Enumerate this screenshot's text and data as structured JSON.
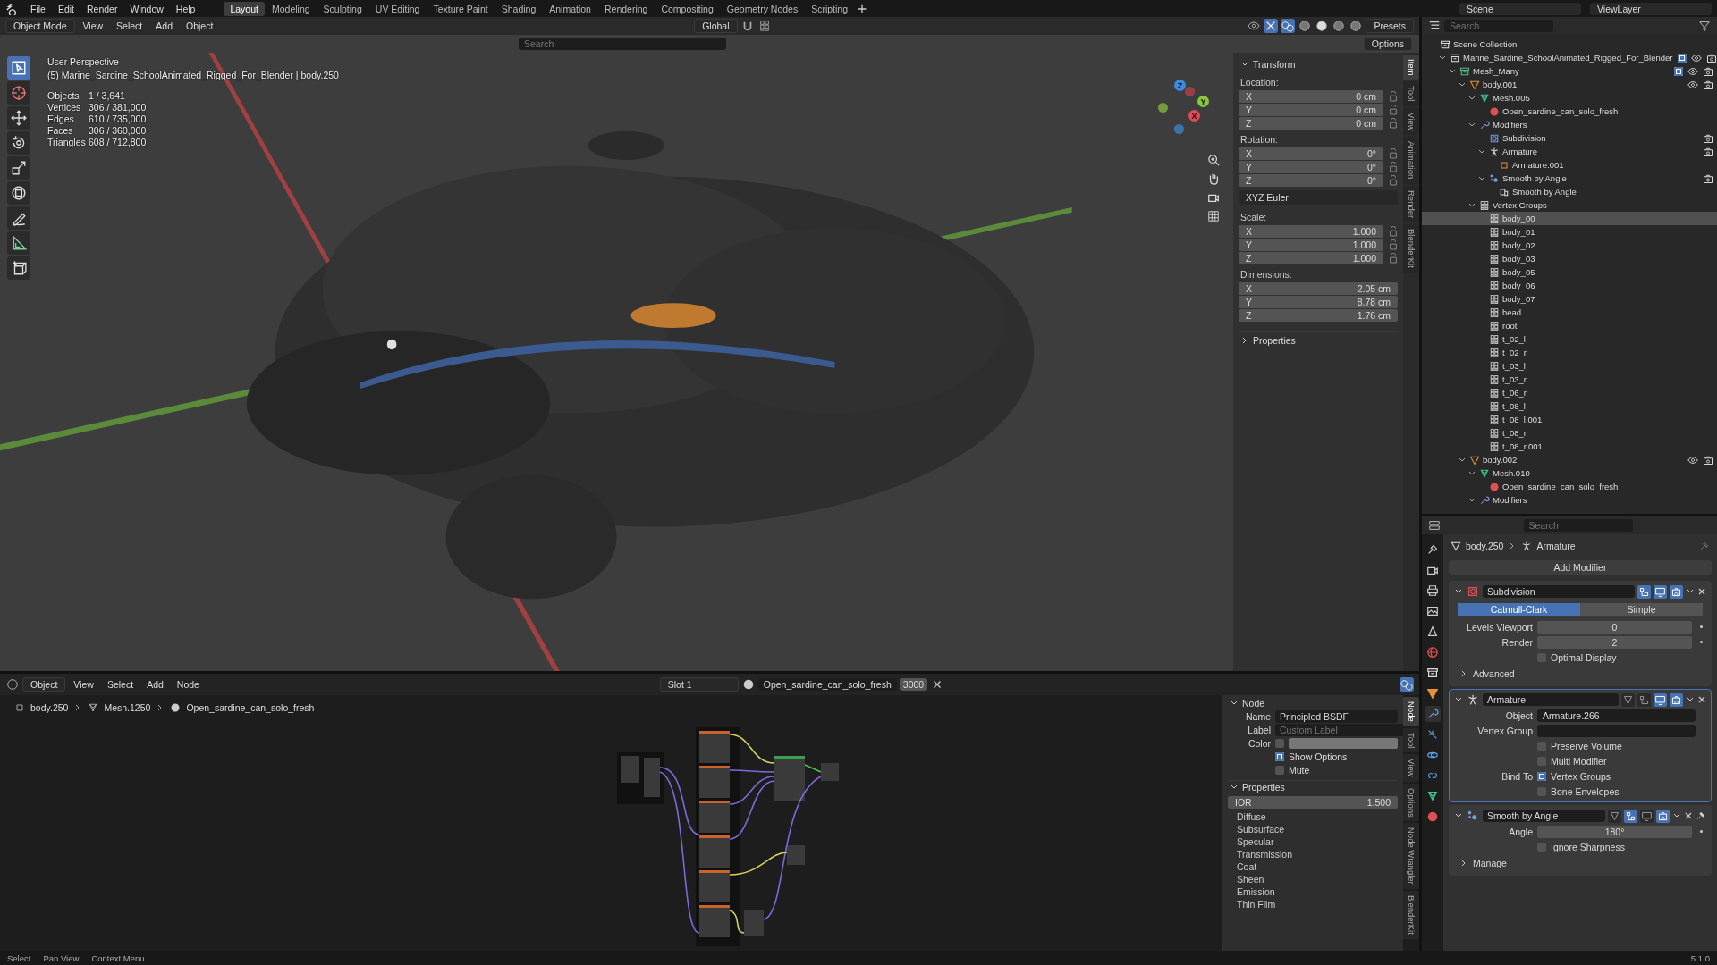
{
  "menu_bar": {
    "menus": [
      "File",
      "Edit",
      "Render",
      "Window",
      "Help"
    ],
    "workspaces": [
      {
        "label": "Layout",
        "selected": true
      },
      {
        "label": "Modeling",
        "selected": false
      },
      {
        "label": "Sculpting",
        "selected": false
      },
      {
        "label": "UV Editing",
        "selected": false
      },
      {
        "label": "Texture Paint",
        "selected": false
      },
      {
        "label": "Shading",
        "selected": false
      },
      {
        "label": "Animation",
        "selected": false
      },
      {
        "label": "Rendering",
        "selected": false
      },
      {
        "label": "Compositing",
        "selected": false
      },
      {
        "label": "Geometry Nodes",
        "selected": false
      },
      {
        "label": "Scripting",
        "selected": false
      }
    ],
    "scene": "Scene",
    "view_layer": "ViewLayer"
  },
  "viewport": {
    "header": {
      "mode": "Object Mode",
      "menus": [
        "View",
        "Select",
        "Add",
        "Object"
      ],
      "orientation": "Global",
      "presets": "Presets"
    },
    "tool_row": {
      "search": {
        "placeholder": "Search"
      },
      "options": "Options"
    },
    "view_name": "User Perspective",
    "object_info": "(5) Marine_Sardine_SchoolAnimated_Rigged_For_Blender | body.250",
    "stats": [
      {
        "label": "Objects",
        "value": "1 / 3,641"
      },
      {
        "label": "Vertices",
        "value": "306 / 381,000"
      },
      {
        "label": "Edges",
        "value": "610 / 735,000"
      },
      {
        "label": "Faces",
        "value": "306 / 360,000"
      },
      {
        "label": "Triangles",
        "value": "608 / 712,800"
      }
    ],
    "tools": [
      {
        "kind": "select",
        "selected": true
      },
      {
        "kind": "cursor",
        "selected": false
      },
      {
        "kind": "move",
        "selected": false
      },
      {
        "kind": "rotate",
        "selected": false
      },
      {
        "kind": "scale",
        "selected": false
      },
      {
        "kind": "transform",
        "selected": false
      },
      {
        "kind": "annotate",
        "selected": false
      },
      {
        "kind": "measure",
        "selected": false
      },
      {
        "kind": "add_cube",
        "selected": false
      }
    ],
    "gizmo": [
      "X",
      "Y",
      "Z"
    ]
  },
  "sidebar": {
    "tabs": [
      {
        "label": "Item",
        "selected": true
      },
      {
        "label": "Tool",
        "selected": false
      },
      {
        "label": "View",
        "selected": false
      },
      {
        "label": "Animation",
        "selected": false
      },
      {
        "label": "Render",
        "selected": false
      },
      {
        "label": "BlenderKit",
        "selected": false
      }
    ],
    "transform": {
      "title": "Transform",
      "expanded": true,
      "rows": [
        {
          "kind": "heading",
          "label": "Location:"
        },
        {
          "kind": "field",
          "axis": "X",
          "value": "0 cm",
          "locked": false
        },
        {
          "kind": "field",
          "axis": "Y",
          "value": "0 cm",
          "locked": false
        },
        {
          "kind": "field",
          "axis": "Z",
          "value": "0 cm",
          "locked": false
        },
        {
          "kind": "heading",
          "label": "Rotation:"
        },
        {
          "kind": "field",
          "axis": "X",
          "value": "0°",
          "locked": false
        },
        {
          "kind": "field",
          "axis": "Y",
          "value": "0°",
          "locked": false
        },
        {
          "kind": "field",
          "axis": "Z",
          "value": "0°",
          "locked": false
        },
        {
          "kind": "dropdown",
          "value": "XYZ Euler"
        },
        {
          "kind": "heading",
          "label": "Scale:"
        },
        {
          "kind": "field",
          "axis": "X",
          "value": "1.000",
          "locked": false
        },
        {
          "kind": "field",
          "axis": "Y",
          "value": "1.000",
          "locked": false
        },
        {
          "kind": "field",
          "axis": "Z",
          "value": "1.000",
          "locked": false
        },
        {
          "kind": "heading",
          "label": "Dimensions:"
        },
        {
          "kind": "field",
          "axis": "X",
          "value": "2.05 cm"
        },
        {
          "kind": "field",
          "axis": "Y",
          "value": "8.78 cm"
        },
        {
          "kind": "field",
          "axis": "Z",
          "value": "1.76 cm"
        }
      ]
    },
    "properties_panel": {
      "title": "Properties",
      "expanded": false
    }
  },
  "outliner": {
    "search": {
      "placeholder": "Search"
    },
    "items": [
      {
        "label": "Scene Collection",
        "kind": "collection",
        "selected": false,
        "children": [
          {
            "label": "Marine_Sardine_SchoolAnimated_Rigged_For_Blender",
            "kind": "collection",
            "selected": false,
            "expanded": true,
            "included": true,
            "visible": true,
            "renderable": true,
            "children": [
              {
                "label": "Mesh_Many",
                "kind": "collection_green",
                "selected": false,
                "expanded": true,
                "included": true,
                "visible": true,
                "renderable": true,
                "children": [
                  {
                    "label": "body.001",
                    "kind": "object",
                    "selected": false,
                    "expanded": true,
                    "visible": true,
                    "renderable": true,
                    "children": [
                      {
                        "label": "Mesh.005",
                        "kind": "mesh",
                        "selected": false,
                        "expanded": true,
                        "children": [
                          {
                            "label": "Open_sardine_can_solo_fresh",
                            "kind": "material",
                            "selected": false
                          }
                        ]
                      },
                      {
                        "label": "Modifiers",
                        "kind": "modifiers",
                        "selected": false,
                        "expanded": true,
                        "children": [
                          {
                            "label": "Subdivision",
                            "kind": "subdivision",
                            "selected": false,
                            "renderable": true
                          },
                          {
                            "label": "Armature",
                            "kind": "armature_mod",
                            "selected": false,
                            "expanded": true,
                            "renderable": true,
                            "children": [
                              {
                                "label": "Armature.001",
                                "kind": "armature",
                                "selected": false
                              }
                            ]
                          },
                          {
                            "label": "Smooth by Angle",
                            "kind": "smooth",
                            "selected": false,
                            "expanded": true,
                            "renderable": true,
                            "children": [
                              {
                                "label": "Smooth by Angle",
                                "kind": "nodes",
                                "selected": false
                              }
                            ]
                          }
                        ]
                      },
                      {
                        "label": "Vertex Groups",
                        "kind": "vertex_group",
                        "selected": false,
                        "expanded": true,
                        "children": [
                          {
                            "label": "body_00",
                            "kind": "vertex_group",
                            "selected": true
                          },
                          {
                            "label": "body_01",
                            "kind": "vertex_group",
                            "selected": false
                          },
                          {
                            "label": "body_02",
                            "kind": "vertex_group",
                            "selected": false
                          },
                          {
                            "label": "body_03",
                            "kind": "vertex_group",
                            "selected": false
                          },
                          {
                            "label": "body_05",
                            "kind": "vertex_group",
                            "selected": false
                          },
                          {
                            "label": "body_06",
                            "kind": "vertex_group",
                            "selected": false
                          },
                          {
                            "label": "body_07",
                            "kind": "vertex_group",
                            "selected": false
                          },
                          {
                            "label": "head",
                            "kind": "vertex_group",
                            "selected": false
                          },
                          {
                            "label": "root",
                            "kind": "vertex_group",
                            "selected": false
                          },
                          {
                            "label": "t_02_l",
                            "kind": "vertex_group",
                            "selected": false
                          },
                          {
                            "label": "t_02_r",
                            "kind": "vertex_group",
                            "selected": false
                          },
                          {
                            "label": "t_03_l",
                            "kind": "vertex_group",
                            "selected": false
                          },
                          {
                            "label": "t_03_r",
                            "kind": "vertex_group",
                            "selected": false
                          },
                          {
                            "label": "t_06_r",
                            "kind": "vertex_group",
                            "selected": false
                          },
                          {
                            "label": "t_08_l",
                            "kind": "vertex_group",
                            "selected": false
                          },
                          {
                            "label": "t_08_l.001",
                            "kind": "vertex_group",
                            "selected": false
                          },
                          {
                            "label": "t_08_r",
                            "kind": "vertex_group",
                            "selected": false
                          },
                          {
                            "label": "t_08_r.001",
                            "kind": "vertex_group",
                            "selected": false
                          }
                        ]
                      }
                    ]
                  },
                  {
                    "label": "body.002",
                    "kind": "object",
                    "selected": false,
                    "expanded": true,
                    "visible": true,
                    "renderable": true,
                    "children": [
                      {
                        "label": "Mesh.010",
                        "kind": "mesh",
                        "selected": false,
                        "expanded": true,
                        "children": [
                          {
                            "label": "Open_sardine_can_solo_fresh",
                            "kind": "material",
                            "selected": false
                          }
                        ]
                      },
                      {
                        "label": "Modifiers",
                        "kind": "modifiers",
                        "selected": false,
                        "expanded": true
                      }
                    ]
                  }
                ]
              }
            ]
          }
        ]
      }
    ]
  },
  "properties": {
    "search": {
      "placeholder": "Search"
    },
    "tabs": [
      {
        "kind": "tool",
        "selected": false
      },
      {
        "kind": "render",
        "selected": false
      },
      {
        "kind": "output",
        "selected": false
      },
      {
        "kind": "view_layer",
        "selected": false
      },
      {
        "kind": "scene",
        "selected": false
      },
      {
        "kind": "world",
        "selected": false
      },
      {
        "kind": "collection",
        "selected": false
      },
      {
        "kind": "object",
        "selected": false
      },
      {
        "kind": "modifiers",
        "selected": true
      },
      {
        "kind": "particles",
        "selected": false
      },
      {
        "kind": "physics",
        "selected": false
      },
      {
        "kind": "constraints",
        "selected": false
      },
      {
        "kind": "data",
        "selected": false
      },
      {
        "kind": "material",
        "selected": false
      }
    ],
    "breadcrumb": [
      {
        "label": "body.250",
        "kind": "object"
      },
      {
        "label": "Armature",
        "kind": "armature_mod"
      }
    ],
    "add_modifier": "Add Modifier",
    "modifiers": [
      {
        "kind": "subdivision",
        "name": "Subdivision",
        "expanded": true,
        "active": false,
        "pinned": false,
        "toggles": [
          {
            "kind": "edit",
            "on": true
          },
          {
            "kind": "viewport",
            "on": true
          },
          {
            "kind": "render",
            "on": true
          }
        ],
        "rows": [
          {
            "kind": "segmented",
            "options": [
              {
                "label": "Catmull-Clark",
                "selected": true
              },
              {
                "label": "Simple",
                "selected": false
              }
            ]
          },
          {
            "kind": "field",
            "label": "Levels Viewport",
            "value": "0"
          },
          {
            "kind": "field",
            "label": "Render",
            "value": "2"
          },
          {
            "kind": "check",
            "text": "Optimal Display",
            "checked": false
          },
          {
            "kind": "subpanel",
            "label": "Advanced",
            "expanded": false
          }
        ]
      },
      {
        "kind": "armature_mod",
        "name": "Armature",
        "expanded": true,
        "active": true,
        "pinned": false,
        "toggles": [
          {
            "kind": "cage",
            "on": false
          },
          {
            "kind": "edit",
            "on": false
          },
          {
            "kind": "viewport",
            "on": true
          },
          {
            "kind": "render",
            "on": true
          }
        ],
        "rows": [
          {
            "kind": "object",
            "label": "Object",
            "value": "Armature.266"
          },
          {
            "kind": "group",
            "label": "Vertex Group"
          },
          {
            "kind": "check",
            "text": "Preserve Volume",
            "checked": false
          },
          {
            "kind": "check",
            "text": "Multi Modifier",
            "checked": false
          },
          {
            "kind": "check",
            "label": "Bind To",
            "text": "Vertex Groups",
            "checked": true
          },
          {
            "kind": "check",
            "text": "Bone Envelopes",
            "checked": false
          }
        ]
      },
      {
        "kind": "smooth",
        "name": "Smooth by Angle",
        "expanded": true,
        "active": false,
        "pinned": true,
        "toggles": [
          {
            "kind": "cage",
            "on": false
          },
          {
            "kind": "edit",
            "on": true
          },
          {
            "kind": "viewport",
            "on": false
          },
          {
            "kind": "render",
            "on": true
          }
        ],
        "rows": [
          {
            "kind": "field",
            "label": "Angle",
            "value": "180°"
          },
          {
            "kind": "check",
            "text": "Ignore Sharpness",
            "checked": false
          },
          {
            "kind": "subpanel",
            "label": "Manage",
            "expanded": false
          }
        ]
      }
    ]
  },
  "node_editor": {
    "header": {
      "mode": "Object",
      "menus": [
        "View",
        "Select",
        "Add",
        "Node"
      ],
      "slot": "Slot 1",
      "material": "Open_sardine_can_solo_fresh",
      "users": "3000"
    },
    "breadcrumb": [
      {
        "label": "body.250",
        "kind": "armature"
      },
      {
        "label": "Mesh.1250",
        "kind": "mesh"
      },
      {
        "label": "Open_sardine_can_solo_fresh",
        "kind": "material"
      }
    ],
    "tabs": [
      {
        "label": "Node",
        "selected": true
      },
      {
        "label": "Tool",
        "selected": false
      },
      {
        "label": "View",
        "selected": false
      },
      {
        "label": "Options",
        "selected": false
      },
      {
        "label": "Node Wrangler",
        "selected": false
      },
      {
        "label": "BlenderKit",
        "selected": false
      }
    ],
    "node_panel": {
      "title": "Node",
      "expanded": true,
      "name": {
        "label": "Name",
        "value": "Principled BSDF"
      },
      "label": {
        "label": "Label",
        "placeholder": "Custom Label"
      },
      "color": {
        "label": "Color",
        "checked": false
      },
      "checks": [
        {
          "label": "Show Options",
          "checked": true
        },
        {
          "label": "Mute",
          "checked": false
        }
      ]
    },
    "properties_panel": {
      "title": "Properties",
      "expanded": true,
      "ior": {
        "label": "IOR",
        "value": "1.500"
      },
      "subpanels": [
        "Diffuse",
        "Subsurface",
        "Specular",
        "Transmission",
        "Coat",
        "Sheen",
        "Emission",
        "Thin Film"
      ]
    }
  },
  "status_bar": {
    "hints": [
      "Select",
      "Pan View",
      "Context Menu"
    ],
    "version": "5.1.0"
  }
}
